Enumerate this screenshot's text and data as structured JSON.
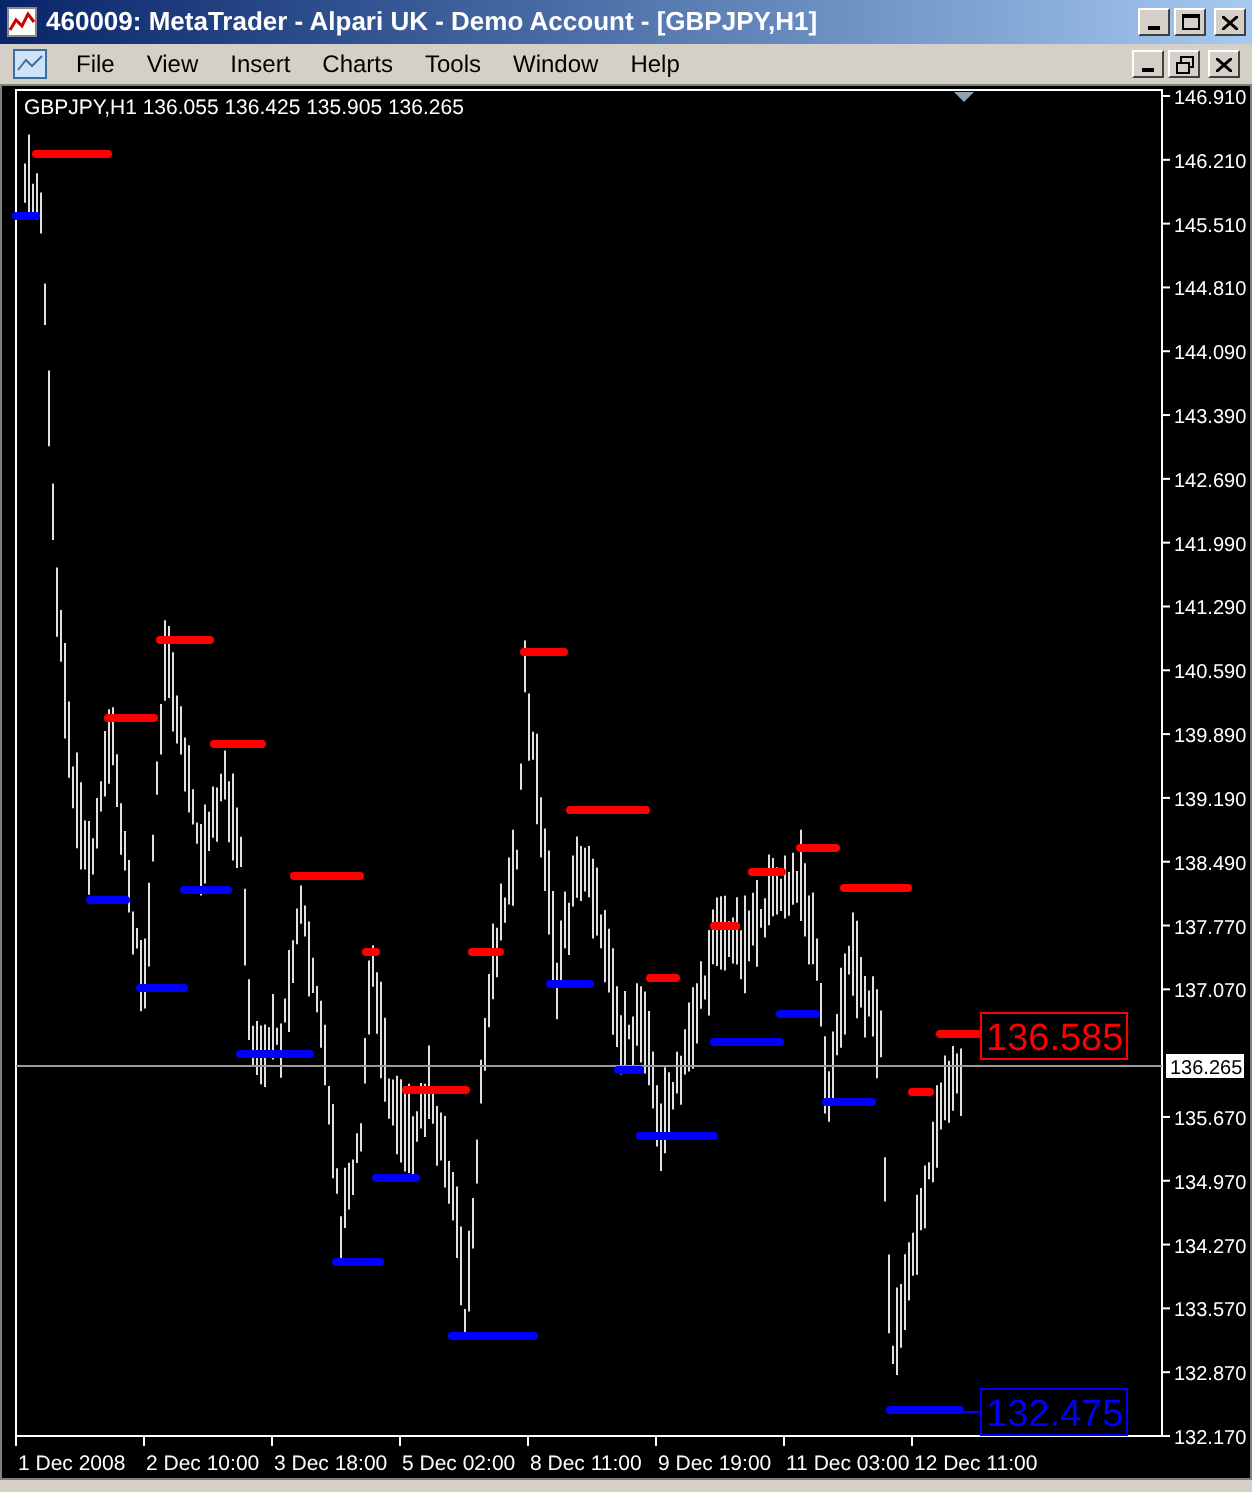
{
  "window": {
    "title": "460009: MetaTrader - Alpari UK - Demo Account - [GBPJPY,H1]"
  },
  "menu": [
    "File",
    "View",
    "Insert",
    "Charts",
    "Tools",
    "Window",
    "Help"
  ],
  "chart": {
    "symbol": "GBPJPY,H1",
    "ohlc": [
      "136.055",
      "136.425",
      "135.905",
      "136.265"
    ],
    "price_axis": [
      "146.910",
      "146.210",
      "145.510",
      "144.810",
      "144.090",
      "143.390",
      "142.690",
      "141.990",
      "141.290",
      "140.590",
      "139.890",
      "139.190",
      "138.490",
      "137.770",
      "137.070",
      "135.670",
      "134.970",
      "134.270",
      "133.570",
      "132.870",
      "132.170"
    ],
    "time_axis": [
      "1 Dec 2008",
      "2 Dec 10:00",
      "3 Dec 18:00",
      "5 Dec 02:00",
      "8 Dec 11:00",
      "9 Dec 19:00",
      "11 Dec 03:00",
      "12 Dec 11:00"
    ],
    "current_price": "136.265",
    "resistance_label": "136.585",
    "support_label": "132.475"
  }
}
